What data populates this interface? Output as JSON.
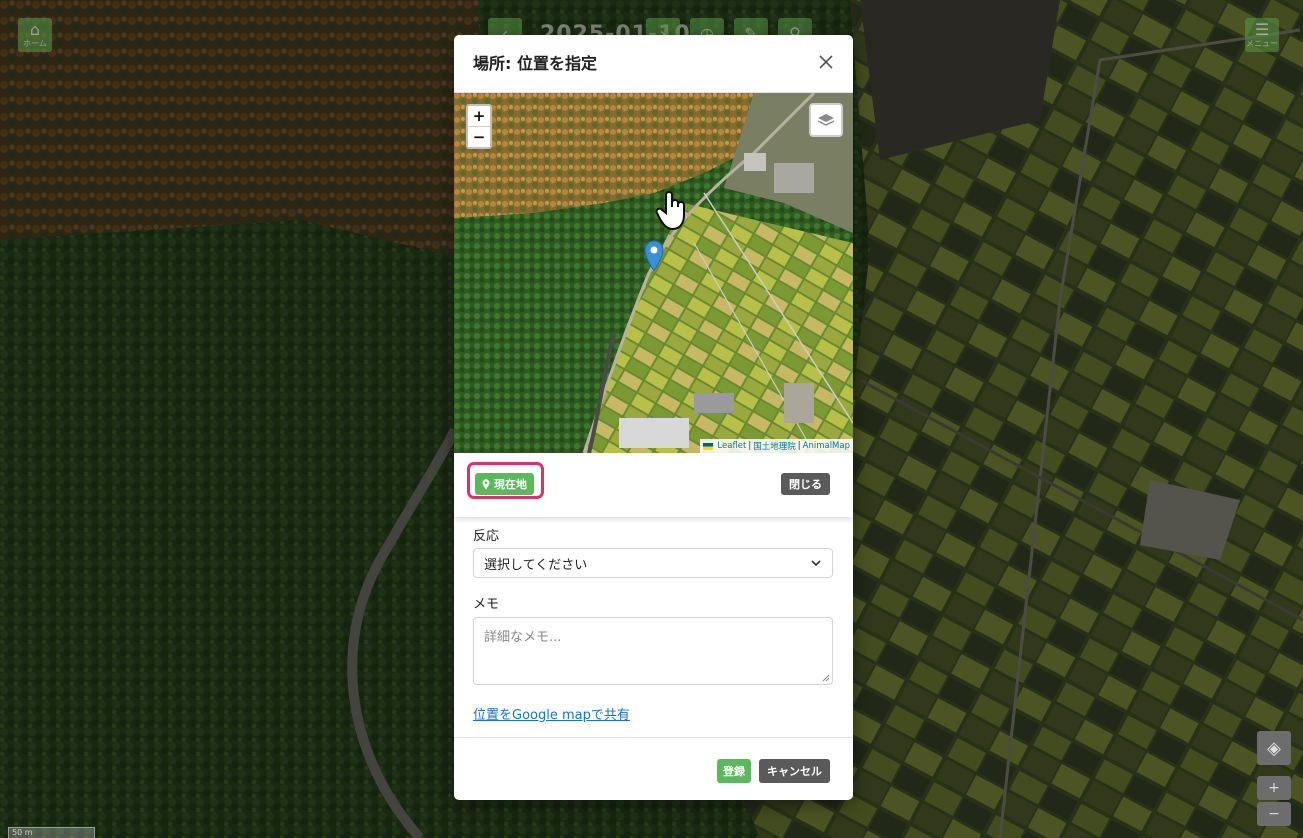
{
  "topbar": {
    "home_label": "ホーム",
    "date": "2025-01-10",
    "menu_label": "メニュー"
  },
  "modal": {
    "title": "場所: 位置を指定",
    "map": {
      "zoom_in": "+",
      "zoom_out": "−",
      "attribution": {
        "leaflet": "Leaflet",
        "separator": "|",
        "gsi": "国土地理院",
        "animalmap": "AnimalMap"
      }
    },
    "current_location_label": "現在地",
    "close_map_label": "閉じる",
    "reaction_label": "反応",
    "reaction_select_value": "選択してください",
    "memo_label": "メモ",
    "memo_placeholder": "詳細なメモ...",
    "share_link": "位置をGoogle mapで共有",
    "submit_label": "登録",
    "cancel_label": "キャンセル"
  },
  "bg_map": {
    "zoom_in": "+",
    "zoom_out": "−",
    "scale": "50 m"
  },
  "colors": {
    "accent_green": "#5cb85c",
    "highlight": "#e0306a",
    "dark_button": "#5a5a5a",
    "link": "#1a6fd8",
    "marker": "#3a8fd6"
  }
}
